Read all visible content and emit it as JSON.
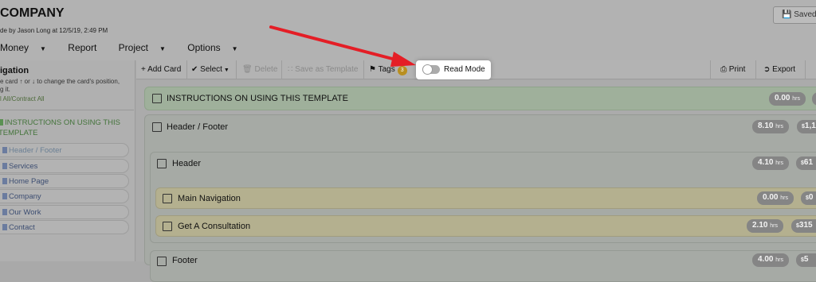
{
  "header": {
    "title": "COMPANY",
    "subtitle": "de by Jason Long at 12/5/19, 2:49 PM",
    "saved_label": "Saved",
    "menu": [
      {
        "label": "Money"
      },
      {
        "label": "Report"
      },
      {
        "label": "Project"
      },
      {
        "label": "Options"
      }
    ]
  },
  "sidebar": {
    "title": "igation",
    "help_line1": "e card ↑ or ↓ to change the card's position,",
    "help_line2": "g it.",
    "expand_link": "l All/Contract All",
    "items": [
      {
        "label": "INSTRUCTIONS ON USING THIS"
      },
      {
        "label": "TEMPLATE"
      },
      {
        "label": "Header / Footer"
      },
      {
        "label": "Services"
      },
      {
        "label": "Home Page"
      },
      {
        "label": "Company"
      },
      {
        "label": "Our Work"
      },
      {
        "label": "Contact"
      }
    ]
  },
  "toolbar": {
    "add_card": "Add Card",
    "select": "Select",
    "delete": "Delete",
    "save_template": "Save as Template",
    "tags": "Tags",
    "tags_count": "3",
    "read_mode": "Read Mode",
    "print": "Print",
    "export": "Export"
  },
  "cards": {
    "instructions": {
      "label": "INSTRUCTIONS ON USING THIS TEMPLATE",
      "hours": "0.00",
      "unit": "hrs"
    },
    "header_footer": {
      "label": "Header / Footer",
      "hours": "8.10",
      "unit": "hrs",
      "cost_prefix": "$",
      "cost": "1,1"
    },
    "header": {
      "label": "Header",
      "hours": "4.10",
      "unit": "hrs",
      "cost_prefix": "$",
      "cost": "61"
    },
    "main_navigation": {
      "label": "Main Navigation",
      "hours": "0.00",
      "unit": "hrs",
      "cost_prefix": "$",
      "cost": "0"
    },
    "get_consultation": {
      "label": "Get A Consultation",
      "hours": "2.10",
      "unit": "hrs",
      "cost_prefix": "$",
      "cost": "315"
    },
    "footer": {
      "label": "Footer",
      "hours": "4.00",
      "unit": "hrs",
      "cost_prefix": "$",
      "cost": "5"
    }
  },
  "colors": {
    "overlay": "#a9a9a9",
    "green_card": "#9fb09b",
    "gray_card": "#a6aaa5",
    "yellow_card": "#b4b08f",
    "arrow": "#e41e26",
    "tag_badge": "#b98f20"
  },
  "icons": [
    "plus-icon",
    "check-icon",
    "trash-icon",
    "template-icon",
    "tag-icon",
    "printer-icon",
    "export-icon",
    "save-icon",
    "caret-down-icon"
  ]
}
